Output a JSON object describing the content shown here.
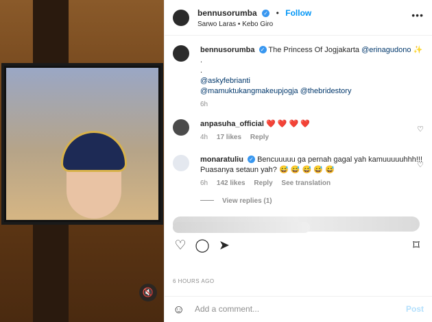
{
  "header": {
    "username": "bennusorumba",
    "verified_icon": "verified-badge-icon",
    "separator": "•",
    "follow_label": "Follow",
    "location": "Sarwo Laras • Kebo Giro",
    "more_icon": "more-options-icon"
  },
  "caption": {
    "username": "bennusorumba",
    "text_before": "The Princess Of Jogjakarta ",
    "mention_1": "@erinagudono",
    "sparkle": "✨",
    "dot_1": ".",
    "dot_2": ".",
    "mention_2": "@askyfebrianti",
    "mention_3": "@mamuktukangmakeupjogja",
    "mention_4": "@thebridestory",
    "time": "6h"
  },
  "comments": [
    {
      "username": "anpasuha_official",
      "text": "❤️ ❤️ ❤️ ❤️",
      "time": "4h",
      "likes": "17 likes",
      "reply": "Reply"
    },
    {
      "username": "monaratuliu",
      "text": "Bencuuuuu ga pernah gagal yah kamuuuuuhhh!!! Puasanya setaun yah? 😅 😅 😅 😅 😅",
      "time": "6h",
      "likes": "142 likes",
      "reply": "Reply",
      "translate": "See translation"
    }
  ],
  "view_replies": "View replies (1)",
  "timestamp": "6 HOURS AGO",
  "add_comment": {
    "placeholder": "Add a comment...",
    "post_label": "Post"
  },
  "icons": {
    "like": "heart-icon",
    "comment": "comment-icon",
    "share": "share-icon",
    "save": "bookmark-icon",
    "emoji": "emoji-icon",
    "mute": "speaker-muted-icon"
  }
}
